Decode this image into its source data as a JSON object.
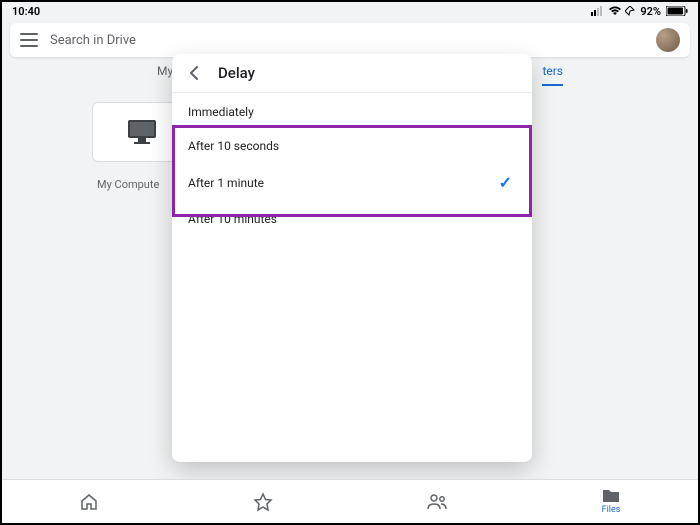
{
  "status_bar": {
    "time": "10:40",
    "battery_percent": "92%"
  },
  "search": {
    "placeholder": "Search in Drive"
  },
  "tabs": {
    "left_partial": "My",
    "right_partial": "ters"
  },
  "folder": {
    "label": "My Compute"
  },
  "modal": {
    "title": "Delay",
    "options": [
      {
        "label": "Immediately",
        "selected": false
      },
      {
        "label": "After 10 seconds",
        "selected": false
      },
      {
        "label": "After 1 minute",
        "selected": true
      },
      {
        "label": "After 10 minutes",
        "selected": false
      }
    ]
  },
  "bottom_nav": {
    "files_label": "Files"
  }
}
